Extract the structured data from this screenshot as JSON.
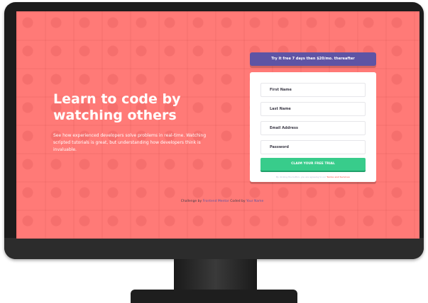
{
  "hero": {
    "title": "Learn to code by watching others",
    "description": "See how experienced developers solve problems in real-time. Watching scripted tutorials is great, but understanding how developers think is invaluable."
  },
  "offer": {
    "text": "Try it free 7 days then $20/mo. thereafter"
  },
  "form": {
    "first_name_placeholder": "First Name",
    "last_name_placeholder": "Last Name",
    "email_placeholder": "Email Address",
    "password_placeholder": "Password",
    "submit_label": "CLAIM YOUR FREE TRIAL",
    "terms_prefix": "By clicking the button, you are agreeing to our",
    "terms_link": "Terms and Services"
  },
  "attribution": {
    "prefix": "Challenge by",
    "challenge_link": "Frontend Mentor",
    "middle": "Coded by",
    "author_link": "Your Name"
  },
  "colors": {
    "background": "#ff7a77",
    "offer_banner": "#5e54a4",
    "cta": "#38cc8b",
    "text_dark": "#3d3b48"
  }
}
